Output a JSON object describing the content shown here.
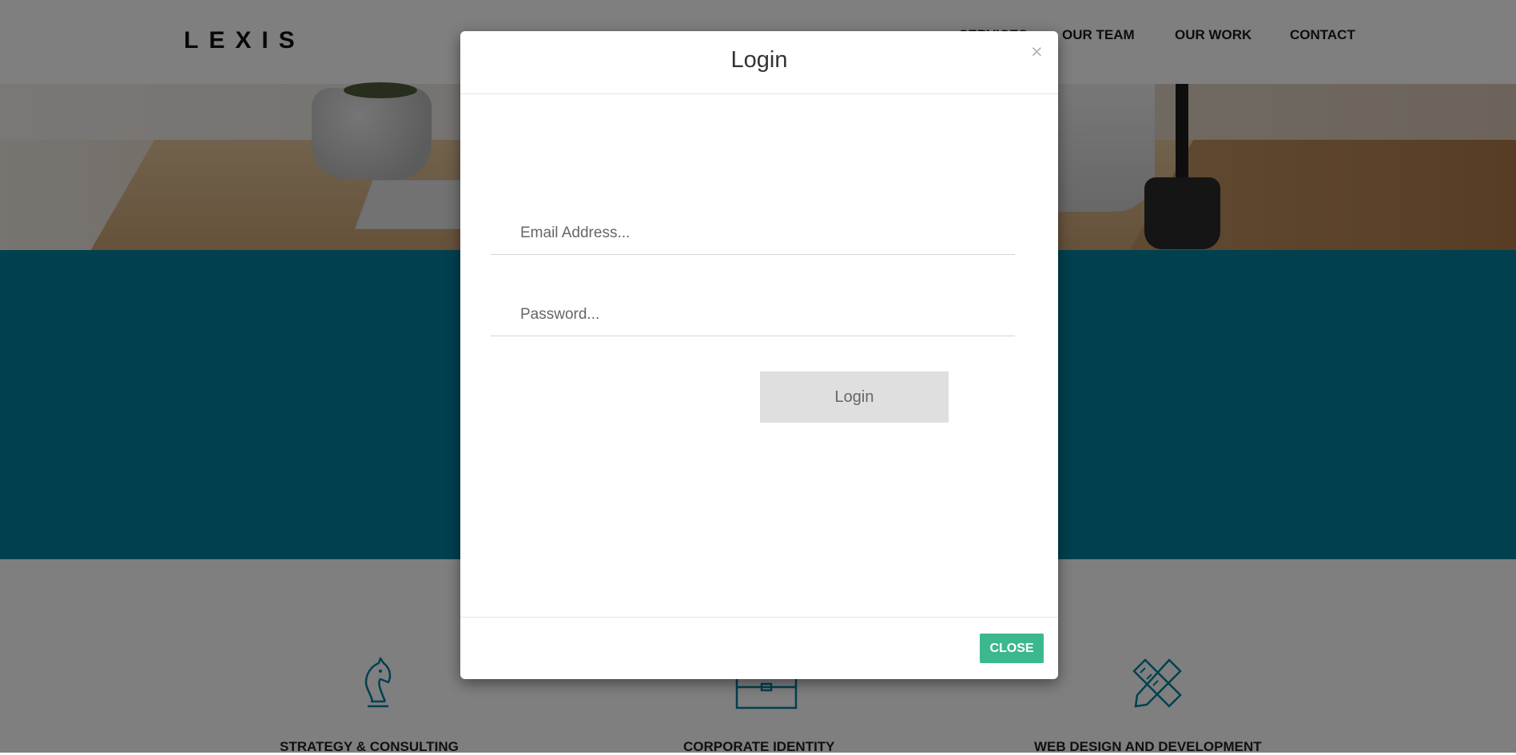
{
  "site": {
    "brand": "LEXIS",
    "nav": [
      {
        "label": "SERVICES"
      },
      {
        "label": "OUR TEAM"
      },
      {
        "label": "OUR WORK"
      },
      {
        "label": "CONTACT"
      }
    ]
  },
  "services": [
    {
      "title": "STRATEGY & CONSULTING",
      "icon": "chess-knight-icon"
    },
    {
      "title": "CORPORATE IDENTITY",
      "icon": "briefcase-icon"
    },
    {
      "title": "WEB DESIGN AND DEVELOPMENT",
      "icon": "pencil-ruler-icon"
    }
  ],
  "modal": {
    "title": "Login",
    "close_symbol": "×",
    "email_placeholder": "Email Address...",
    "password_placeholder": "Password...",
    "login_label": "Login",
    "close_label": "CLOSE"
  },
  "colors": {
    "band": "#00809f",
    "close_button": "#3cb88e",
    "login_button": "#dfdfdf",
    "overlay": "rgba(0,0,0,0.5)"
  }
}
